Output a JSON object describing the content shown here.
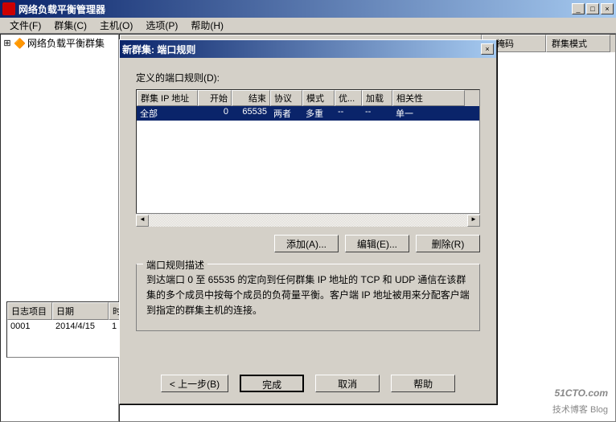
{
  "window": {
    "title": "网络负载平衡管理器",
    "winbtns": {
      "min": "_",
      "max": "□",
      "close": "×"
    }
  },
  "menubar": [
    "文件(F)",
    "群集(C)",
    "主机(O)",
    "选项(P)",
    "帮助(H)"
  ],
  "tree": {
    "root": "网络负载平衡群集"
  },
  "back_columns": [
    "网掩码",
    "群集模式"
  ],
  "log": {
    "headers": [
      "日志项目",
      "日期",
      "时"
    ],
    "row": [
      "0001",
      "2014/4/15",
      "1"
    ]
  },
  "dialog": {
    "title": "新群集:  端口规则",
    "close": "×",
    "label": "定义的端口规则(D):",
    "grid": {
      "headers": [
        "群集 IP 地址",
        "开始",
        "结束",
        "协议",
        "模式",
        "优...",
        "加载",
        "相关性"
      ],
      "row": [
        "全部",
        "0",
        "65535",
        "两者",
        "多重",
        "--",
        "--",
        "单一"
      ]
    },
    "buttons": {
      "add": "添加(A)...",
      "edit": "编辑(E)...",
      "remove": "删除(R)"
    },
    "groupbox_title": "端口规则描述",
    "description": "到达端口 0 至 65535 的定向到任何群集 IP 地址的 TCP 和 UDP 通信在该群集的多个成员中按每个成员的负荷量平衡。客户端 IP 地址被用来分配客户端到指定的群集主机的连接。",
    "footer": {
      "back": "< 上一步(B)",
      "finish": "完成",
      "cancel": "取消",
      "help": "帮助"
    }
  },
  "watermark": {
    "site": "51CTO.com",
    "tag": "技术博客  Blog"
  }
}
